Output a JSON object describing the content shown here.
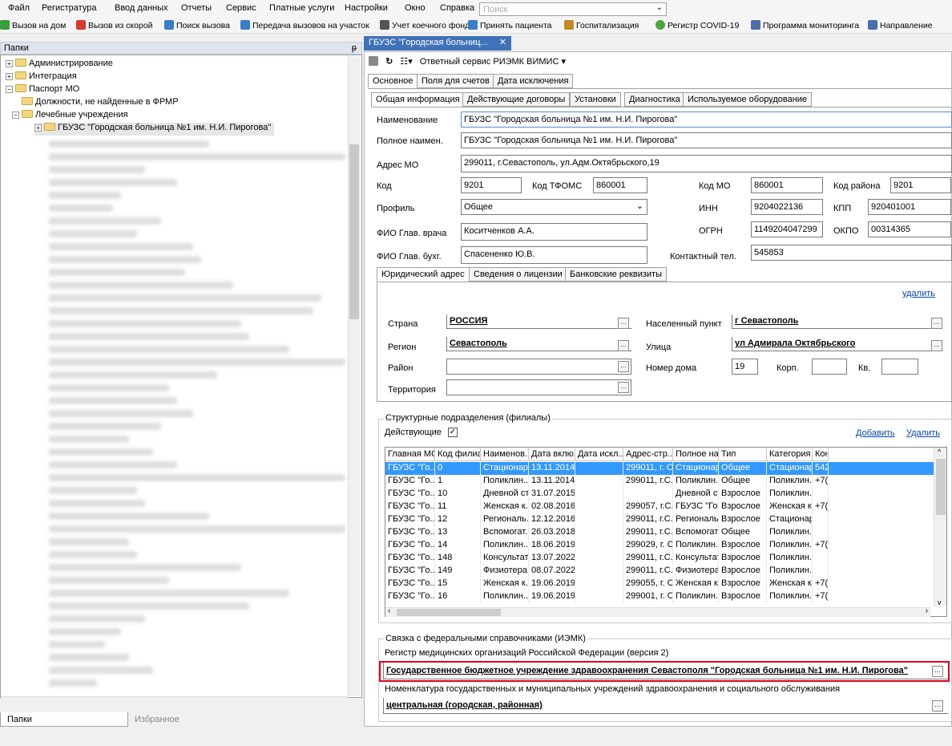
{
  "menu": [
    "Файл",
    "Регистратура",
    "Ввод данных",
    "Отчеты",
    "Сервис",
    "Платные услуги",
    "Настройки",
    "Окно",
    "Справка"
  ],
  "search_placeholder": "Поиск",
  "toolbar": [
    {
      "label": "Вызов на дом",
      "color": "#3a9c3a"
    },
    {
      "label": "Вызов из скорой",
      "color": "#d63a2f"
    },
    {
      "label": "Поиск вызова",
      "color": "#3a7ec8"
    },
    {
      "label": "Передача вызовов на участок",
      "color": "#3a7ec8"
    },
    {
      "label": "Учет коечного фонда",
      "color": "#555555"
    },
    {
      "label": "Принять пациента",
      "color": "#3a7ec8"
    },
    {
      "label": "Госпитализация",
      "color": "#c28a24"
    },
    {
      "label": "Регистр COVID-19",
      "color": "#4aa63a"
    },
    {
      "label": "Программа мониторинга",
      "color": "#4a6ea8"
    },
    {
      "label": "Направление",
      "color": "#4a6ea8"
    }
  ],
  "left": {
    "header": "Папки",
    "pin": "ᵽ",
    "tree": [
      {
        "label": "Администрирование",
        "level": 0,
        "exp": "+"
      },
      {
        "label": "Интеграция",
        "level": 0,
        "exp": "+"
      },
      {
        "label": "Паспорт МО",
        "level": 0,
        "exp": "−"
      },
      {
        "label": "Должности, не найденные в ФРМР",
        "level": 1,
        "exp": ""
      },
      {
        "label": "Лечебные учреждения",
        "level": 1,
        "exp": "−"
      },
      {
        "label": "ГБУЗС \"Городская больница №1 им. Н.И. Пирогова\"",
        "level": 2,
        "exp": "+"
      }
    ],
    "tabs": [
      "Папки",
      "Избранное"
    ]
  },
  "doc_tab": "ГБУЗС \"Городская больниц...",
  "doc_tab_close": "✕",
  "right_toolbar": {
    "service": "Ответный сервис РИЭМК ВИМИС"
  },
  "tabs_top": [
    "Основное",
    "Поля для счетов",
    "Дата исключения"
  ],
  "tabs_second": [
    "Общая информация",
    "Действующие договоры",
    "Установки",
    "Диагностика",
    "Используемое оборудование"
  ],
  "form": {
    "name_label": "Наименование",
    "name_value": "ГБУЗС \"Городская больница №1 им. Н.И. Пирогова\"",
    "fullname_label": "Полное наимен.",
    "fullname_value": "ГБУЗС \"Городская больница №1 им. Н.И. Пирогова\"",
    "address_label": "Адрес МО",
    "address_value": "299011, г.Севастополь, ул.Адм.Октябрьского,19",
    "code_label": "Код",
    "code_value": "9201",
    "tfoms_label": "Код ТФОМС",
    "tfoms_value": "860001",
    "mo_code_label": "Код МО",
    "mo_code_value": "860001",
    "district_label": "Код района",
    "district_value": "9201",
    "profile_label": "Профиль",
    "profile_value": "Общее",
    "inn_label": "ИНН",
    "inn_value": "9204022136",
    "kpp_label": "КПП",
    "kpp_value": "920401001",
    "chief_label": "ФИО Глав. врача",
    "chief_value": "Коситченков А.А.",
    "ogrn_label": "ОГРН",
    "ogrn_value": "1149204047299",
    "okpo_label": "ОКПО",
    "okpo_value": "00314365",
    "accountant_label": "ФИО Глав. бухг.",
    "accountant_value": "Спасененко Ю.В.",
    "phone_label": "Контактный тел.",
    "phone_value": "545853"
  },
  "address_tabs": [
    "Юридический адрес",
    "Сведения о лицензии",
    "Банковские реквизиты"
  ],
  "address": {
    "delete": "удалить",
    "country_label": "Страна",
    "country_value": "РОССИЯ",
    "region_label": "Регион",
    "region_value": "Севастополь",
    "area_label": "Район",
    "area_value": "",
    "territory_label": "Территория",
    "territory_value": "",
    "city_label": "Населенный пункт",
    "city_value": "г Севастополь",
    "street_label": "Улица",
    "street_value": "ул Адмирала Октябрьского",
    "house_label": "Номер дома",
    "house_value": "19",
    "building_label": "Корп.",
    "building_value": "",
    "apt_label": "Кв.",
    "apt_value": ""
  },
  "branches": {
    "title": "Структурные подразделения (филиалы)",
    "active_label": "Действующие",
    "active_checked": "✓",
    "add": "Добавить",
    "remove": "Удалить",
    "columns": [
      "Главная МО",
      "Код филиа...",
      "Наименов...",
      "Дата вклю...",
      "Дата искл...",
      "Адрес-стр...",
      "Полное на...",
      "Тип",
      "Категория",
      "Кон"
    ],
    "rows": [
      [
        "ГБУЗС \"Го...",
        "0",
        "Стационар...",
        "13.11.2014",
        "",
        "299011, г. С...",
        "Стационар...",
        "Общее",
        "Стационар",
        "542"
      ],
      [
        "ГБУЗС \"Го...",
        "1",
        "Поликлин...",
        "13.11.2014",
        "",
        "299011, г.С...",
        "Поликлин...",
        "Общее",
        "Поликлин...",
        "+7("
      ],
      [
        "ГБУЗС \"Го...",
        "10",
        "Дневной ст...",
        "31.07.2015",
        "",
        "",
        "Дневной ст...",
        "Взрослое",
        "Поликлин...",
        ""
      ],
      [
        "ГБУЗС \"Го...",
        "11",
        "Женская к...",
        "02.08.2016",
        "",
        "299057, г.С...",
        "ГБУЗС \"Го...",
        "Взрослое",
        "Женская к...",
        "+7("
      ],
      [
        "ГБУЗС \"Го...",
        "12",
        "Региональ...",
        "12.12.2016",
        "",
        "299011, г.С...",
        "Региональ...",
        "Взрослое",
        "Стационар",
        ""
      ],
      [
        "ГБУЗС \"Го...",
        "13",
        "Вспомогат...",
        "26.03.2018",
        "",
        "299011, г.С...",
        "Вспомогат...",
        "Общее",
        "Поликлин...",
        ""
      ],
      [
        "ГБУЗС \"Го...",
        "14",
        "Поликлин...",
        "18.06.2019",
        "",
        "299029, г. С...",
        "Поликлин...",
        "Взрослое",
        "Поликлин...",
        "+7("
      ],
      [
        "ГБУЗС \"Го...",
        "148",
        "Консультат...",
        "13.07.2022",
        "",
        "299011, г.С...",
        "Консультат...",
        "Взрослое",
        "Поликлин...",
        ""
      ],
      [
        "ГБУЗС \"Го...",
        "149",
        "Физиотера...",
        "08.07.2022",
        "",
        "299011, г.С...",
        "Физиотера...",
        "Взрослое",
        "Поликлин...",
        ""
      ],
      [
        "ГБУЗС \"Го...",
        "15",
        "Женская к...",
        "19.06.2019",
        "",
        "299055, г. С...",
        "Женская к...",
        "Взрослое",
        "Женская к...",
        "+7("
      ],
      [
        "ГБУЗС \"Го...",
        "16",
        "Поликлин...",
        "19.06.2019",
        "",
        "299001, г. С...",
        "Поликлин...",
        "Взрослое",
        "Поликлин...",
        "+7("
      ]
    ]
  },
  "federal": {
    "title": "Связка с федеральными справочниками (ИЭМК)",
    "registry_label": "Регистр медицинских организаций Российской Федерации (версия 2)",
    "registry_value": "Государственное бюджетное учреждение здравоохранения Севастополя \"Городская больница №1 им. Н.И. Пирогова\"",
    "nomenclature_label": "Номенклатура государственных и муниципальных учреждений здравоохранения и социального обслуживания",
    "nomenclature_value": "центральная (городская, районная)"
  }
}
